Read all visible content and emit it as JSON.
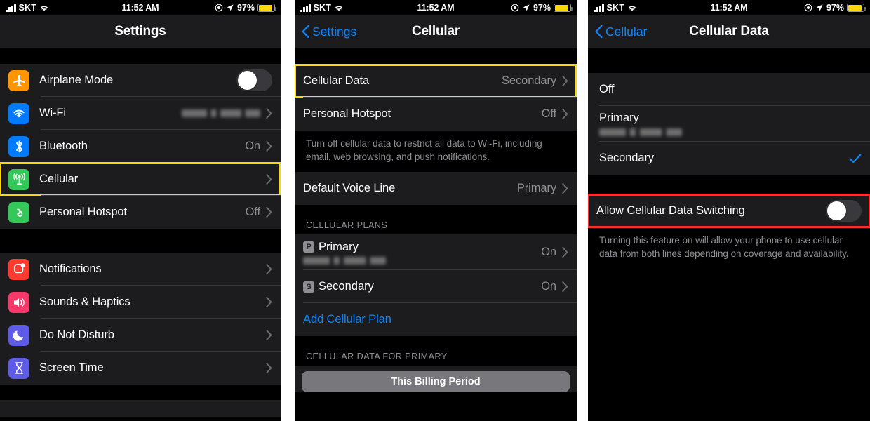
{
  "status_bar": {
    "carrier": "SKT",
    "time": "11:52 AM",
    "battery_percent": "97%",
    "icons": [
      "signal-bars-icon",
      "wifi-icon",
      "alarm-icon",
      "location-arrow-icon",
      "battery-icon"
    ]
  },
  "colors": {
    "accent_blue": "#0a84ff",
    "highlight_yellow": "#ffd60a",
    "highlight_red": "#ff2d2d",
    "group_bg": "#1c1c1e",
    "page_bg": "#000000",
    "secondary_text": "#8e8e93"
  },
  "panel1": {
    "title": "Settings",
    "items": [
      {
        "label": "Airplane Mode",
        "icon": "airplane-icon",
        "icon_color": "#ff9500",
        "control": "toggle",
        "toggle_on": false
      },
      {
        "label": "Wi-Fi",
        "icon": "wifi-icon",
        "icon_color": "#007aff",
        "control": "chevron",
        "value_redacted": true
      },
      {
        "label": "Bluetooth",
        "icon": "bluetooth-icon",
        "icon_color": "#007aff",
        "control": "chevron",
        "value": "On"
      },
      {
        "label": "Cellular",
        "icon": "cellular-antenna-icon",
        "icon_color": "#34c759",
        "control": "chevron",
        "value": "",
        "highlight": "yellow"
      },
      {
        "label": "Personal Hotspot",
        "icon": "personal-hotspot-icon",
        "icon_color": "#34c759",
        "control": "chevron",
        "value": "Off"
      }
    ],
    "items2": [
      {
        "label": "Notifications",
        "icon": "notifications-icon",
        "icon_color": "#ff3b30",
        "control": "chevron",
        "value": ""
      },
      {
        "label": "Sounds & Haptics",
        "icon": "sounds-haptics-icon",
        "icon_color": "#f6386a",
        "control": "chevron",
        "value": ""
      },
      {
        "label": "Do Not Disturb",
        "icon": "do-not-disturb-icon",
        "icon_color": "#5e5ce6",
        "control": "chevron",
        "value": ""
      },
      {
        "label": "Screen Time",
        "icon": "screen-time-icon",
        "icon_color": "#5e5ce6",
        "control": "chevron",
        "value": ""
      }
    ]
  },
  "panel2": {
    "title": "Cellular",
    "back_label": "Settings",
    "rows": [
      {
        "label": "Cellular Data",
        "value": "Secondary",
        "highlight": "yellow"
      },
      {
        "label": "Personal Hotspot",
        "value": "Off"
      }
    ],
    "footnote": "Turn off cellular data to restrict all data to Wi-Fi, including email, web browsing, and push notifications.",
    "voice_row": {
      "label": "Default Voice Line",
      "value": "Primary"
    },
    "plans_header": "CELLULAR PLANS",
    "plans": [
      {
        "badge": "P",
        "label": "Primary",
        "value": "On",
        "subtitle_redacted": true
      },
      {
        "badge": "S",
        "label": "Secondary",
        "value": "On",
        "subtitle_redacted": false
      }
    ],
    "add_plan_label": "Add Cellular Plan",
    "data_header": "CELLULAR DATA FOR PRIMARY",
    "billing_segment": "This Billing Period"
  },
  "panel3": {
    "title": "Cellular Data",
    "back_label": "Cellular",
    "options": [
      {
        "label": "Off",
        "selected": false,
        "subtitle_redacted": false
      },
      {
        "label": "Primary",
        "selected": false,
        "subtitle_redacted": true
      },
      {
        "label": "Secondary",
        "selected": true,
        "subtitle_redacted": false
      }
    ],
    "switching": {
      "label": "Allow Cellular Data Switching",
      "toggle_on": false,
      "highlight": "red"
    },
    "switching_footnote": "Turning this feature on will allow your phone to use cellular data from both lines depending on coverage and availability."
  }
}
